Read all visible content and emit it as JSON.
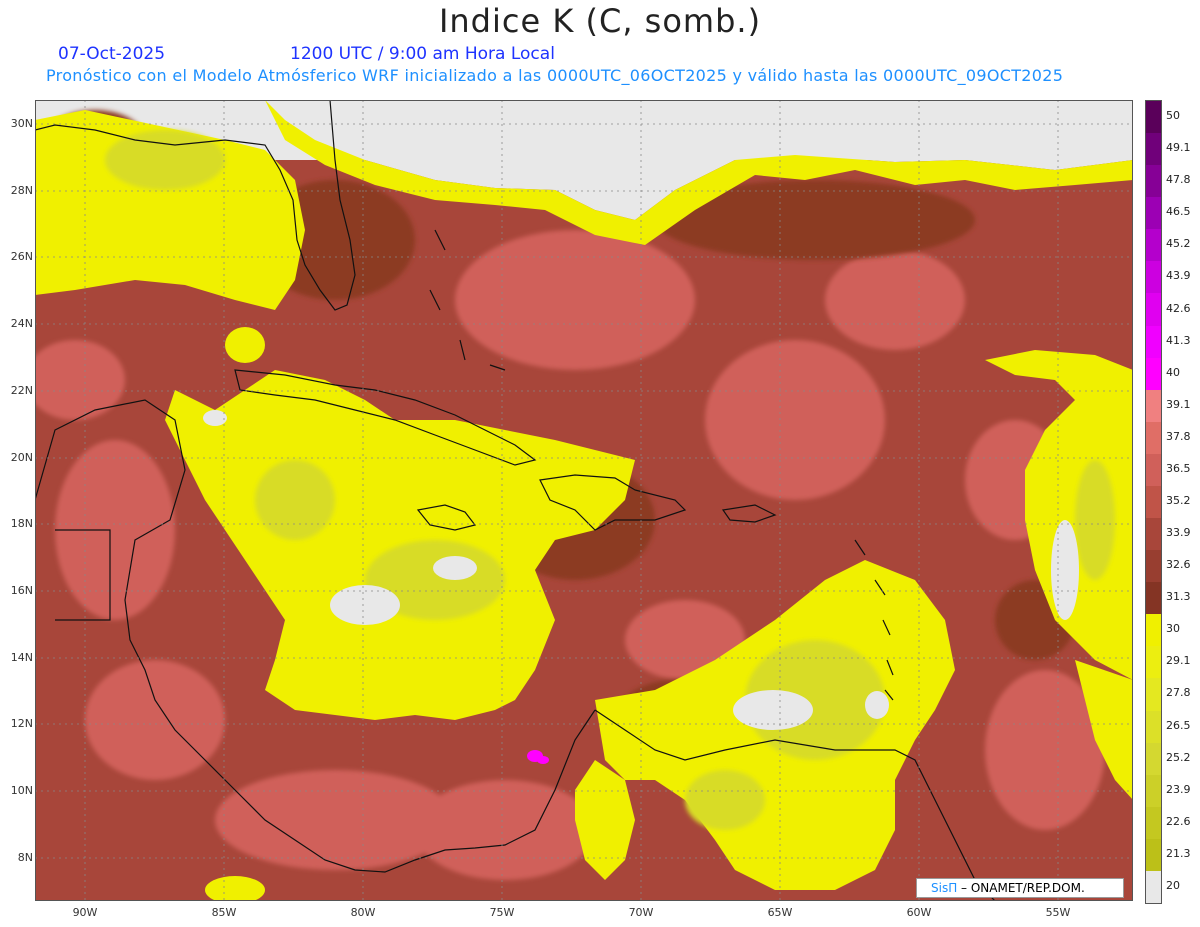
{
  "header": {
    "title": "Indice K (C, somb.)",
    "date": "07-Oct-2025",
    "time": "1200 UTC / 9:00 am Hora Local",
    "description": "Pronóstico con el Modelo Atmósferico WRF inicializado a las 0000UTC_06OCT2025 y válido hasta las  0000UTC_09OCT2025"
  },
  "map": {
    "lat_labels": [
      "30N",
      "28N",
      "26N",
      "24N",
      "22N",
      "20N",
      "18N",
      "16N",
      "14N",
      "12N",
      "10N",
      "8N"
    ],
    "lon_labels": [
      "90W",
      "85W",
      "80W",
      "75W",
      "70W",
      "65W",
      "60W",
      "55W"
    ],
    "colors": {
      "no_data": "#e8e8e8",
      "yellow": "#f0f000",
      "yellow_dark": "#d8dc28",
      "red_dark": "#8c3a22",
      "red_mid": "#b44b3e",
      "red_light": "#d0605a",
      "magenta": "#ff00ff",
      "coast": "#111111"
    }
  },
  "colorbar": {
    "labels": [
      "50",
      "49.1",
      "47.8",
      "46.5",
      "45.2",
      "43.9",
      "42.6",
      "41.3",
      "40",
      "39.1",
      "37.8",
      "36.5",
      "35.2",
      "33.9",
      "32.6",
      "31.3",
      "30",
      "29.1",
      "27.8",
      "26.5",
      "25.2",
      "23.9",
      "22.6",
      "21.3",
      "20"
    ],
    "colors": [
      "#5a005a",
      "#70007a",
      "#860096",
      "#9c00b4",
      "#b400cc",
      "#cc00e0",
      "#e000f0",
      "#f000ff",
      "#ff00ff",
      "#f08080",
      "#e06e66",
      "#d0605a",
      "#c05448",
      "#a8463a",
      "#983e30",
      "#843424",
      "#f0f000",
      "#ecee10",
      "#e4e820",
      "#dce028",
      "#d4d830",
      "#ccd028",
      "#c4c820",
      "#bcc018",
      "#e8e8e8"
    ]
  },
  "credit": {
    "logo": "SisΠ",
    "text": " – ONAMET/REP.DOM."
  }
}
